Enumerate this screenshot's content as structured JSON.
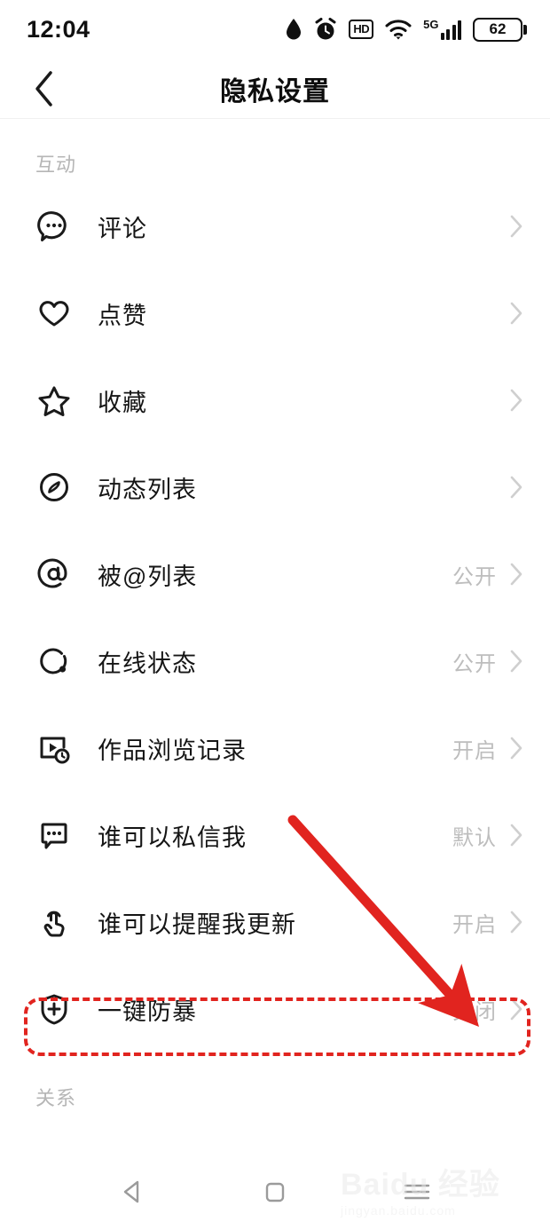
{
  "status_bar": {
    "time": "12:04",
    "battery_level": "62",
    "network_label": "5G",
    "hd_label": "HD",
    "icons": [
      "water-drop-icon",
      "alarm-clock-icon",
      "hd-icon",
      "wifi-icon",
      "signal-5g-icon",
      "battery-icon"
    ]
  },
  "header": {
    "title": "隐私设置",
    "back_icon": "chevron-left-icon"
  },
  "sections": [
    {
      "label": "互动",
      "items": [
        {
          "icon": "comment-bubble-icon",
          "label": "评论",
          "value": ""
        },
        {
          "icon": "heart-icon",
          "label": "点赞",
          "value": ""
        },
        {
          "icon": "star-icon",
          "label": "收藏",
          "value": ""
        },
        {
          "icon": "compass-icon",
          "label": "动态列表",
          "value": ""
        },
        {
          "icon": "at-sign-icon",
          "label": "被@列表",
          "value": "公开"
        },
        {
          "icon": "online-status-icon",
          "label": "在线状态",
          "value": "公开"
        },
        {
          "icon": "video-history-icon",
          "label": "作品浏览记录",
          "value": "开启"
        },
        {
          "icon": "message-bubble-icon",
          "label": "谁可以私信我",
          "value": "默认"
        },
        {
          "icon": "hand-tap-icon",
          "label": "谁可以提醒我更新",
          "value": "开启"
        },
        {
          "icon": "shield-plus-icon",
          "label": "一键防暴",
          "value": "关闭",
          "highlighted": true
        }
      ]
    },
    {
      "label": "关系",
      "items": []
    }
  ],
  "annotation": {
    "color": "#e1241f",
    "arrow_name": "red-pointer-arrow",
    "target_label": "一键防暴"
  },
  "nav_bar": {
    "back_icon": "nav-back-triangle-icon",
    "home_icon": "nav-home-square-icon",
    "recents_icon": "nav-menu-lines-icon"
  },
  "watermark": {
    "brand": "Baidu 经验",
    "url": "jingyan.baidu.com"
  }
}
